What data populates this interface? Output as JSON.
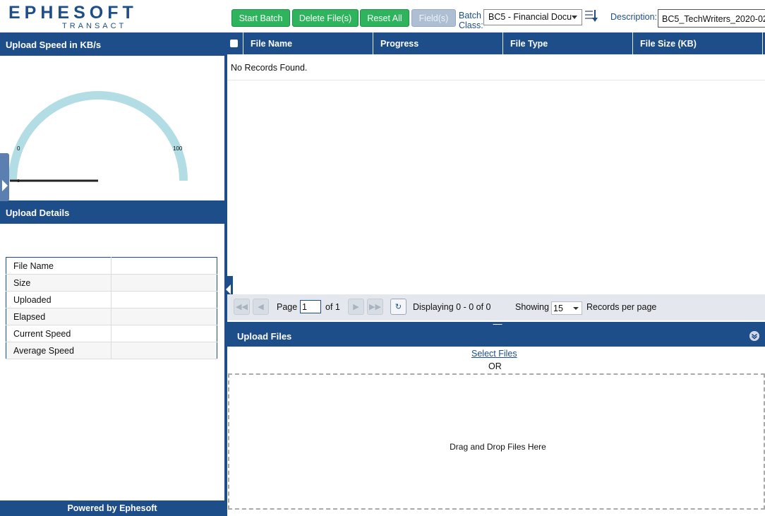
{
  "logo": {
    "main": "EPHESOFT",
    "sub": "TRANSACT"
  },
  "toolbar": {
    "start_batch": "Start Batch",
    "delete_files": "Delete File(s)",
    "reset_all": "Reset All",
    "fields": "Field(s)",
    "batch_class_label_1": "Batch",
    "batch_class_label_2": "Class:",
    "batch_class_value": "BC5 - Financial Docu",
    "description_label": "Description:",
    "description_value": "BC5_TechWriters_2020-02-"
  },
  "left": {
    "speed_title": "Upload Speed in KB/s",
    "gauge_min": "0",
    "gauge_max": "100",
    "details_title": "Upload Details",
    "details_rows": [
      "File Name",
      "Size",
      "Uploaded",
      "Elapsed",
      "Current Speed",
      "Average Speed"
    ],
    "footer": "Powered by Ephesoft"
  },
  "grid": {
    "columns": [
      "File Name",
      "Progress",
      "File Type",
      "File Size (KB)"
    ],
    "empty_message": "No Records Found."
  },
  "pager": {
    "page_label": "Page",
    "page_value": "1",
    "of_label": "of 1",
    "displaying": "Displaying 0 - 0 of 0",
    "showing": "Showing",
    "rpp_value": "15",
    "rpp_label": "Records per page"
  },
  "upload": {
    "title": "Upload Files",
    "select_files": "Select Files",
    "or": "OR",
    "drop_text": "Drag and Drop Files Here"
  },
  "colors": {
    "brand": "#1d4e89",
    "button_green": "#2eb45c",
    "gauge_arc": "#b2dde4"
  }
}
